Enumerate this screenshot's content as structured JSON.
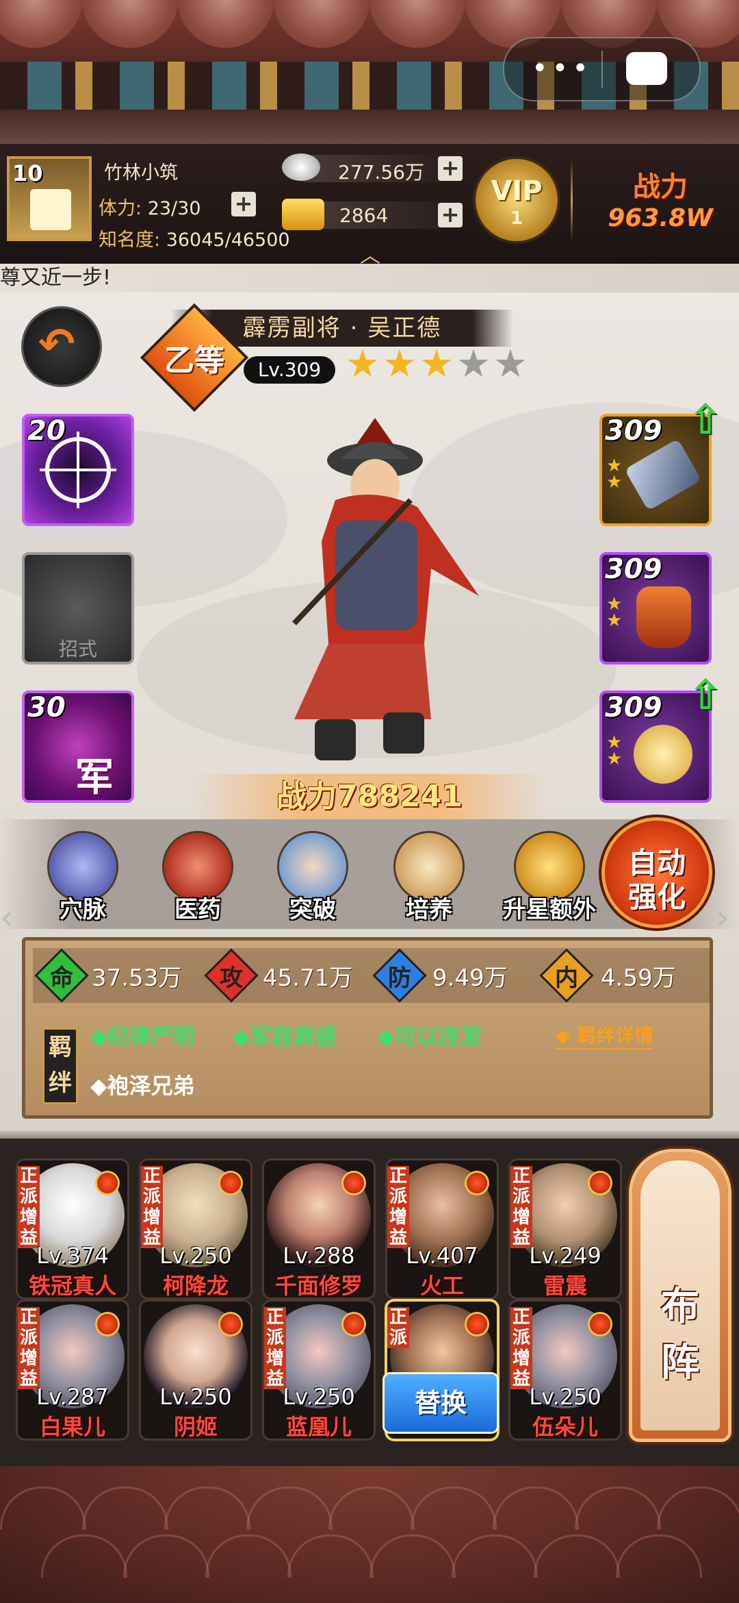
{
  "player": {
    "avatar_level": "10",
    "name": "竹林小筑",
    "stamina_label": "体力:",
    "stamina_value": "23/30",
    "fame_label": "知名度:",
    "fame_value": "36045/46500"
  },
  "currency": {
    "silver": "277.56万",
    "gold": "2864"
  },
  "vip": {
    "label": "VIP",
    "level": "1"
  },
  "top_power": {
    "label": "战力",
    "value": "963.8W"
  },
  "ticker": "尊又近一步!",
  "hero": {
    "title": "霹雳副将 · 吴正德",
    "grade": "乙等",
    "level": "Lv.309",
    "stars_filled": 3,
    "stars_total": 5,
    "power": "战力788241"
  },
  "left_slots": [
    {
      "num": "20",
      "label": ""
    },
    {
      "num": "",
      "label": "招式"
    },
    {
      "num": "30",
      "label": "军"
    }
  ],
  "right_slots": [
    {
      "num": "309"
    },
    {
      "num": "309"
    },
    {
      "num": "309"
    }
  ],
  "functions": [
    "穴脉",
    "医药",
    "突破",
    "培养",
    "升星额外"
  ],
  "auto_button": [
    "自动",
    "强化"
  ],
  "stats": [
    {
      "label": "命",
      "value": "37.53万",
      "color": "#2fbf3a"
    },
    {
      "label": "攻",
      "value": "45.71万",
      "color": "#e0302a"
    },
    {
      "label": "防",
      "value": "9.49万",
      "color": "#2f7fe0"
    },
    {
      "label": "内",
      "value": "4.59万",
      "color": "#e8a020"
    }
  ],
  "bonds": {
    "label": "羁绊",
    "active": [
      "◆纪律严明",
      "◆军容鼎盛",
      "◆可以连发"
    ],
    "inactive": [
      "◆袍泽兄弟"
    ],
    "detail_link": "◆ 羁绊详情"
  },
  "team": [
    {
      "level": "Lv.374",
      "name": "铁冠真人",
      "tag": "正派增益"
    },
    {
      "level": "Lv.250",
      "name": "柯降龙",
      "tag": "正派增益"
    },
    {
      "level": "Lv.288",
      "name": "千面修罗",
      "tag": ""
    },
    {
      "level": "Lv.407",
      "name": "火工",
      "tag": "正派增益"
    },
    {
      "level": "Lv.249",
      "name": "雷震",
      "tag": "正派增益"
    },
    {
      "level": "Lv.287",
      "name": "白果儿",
      "tag": "正派增益"
    },
    {
      "level": "Lv.250",
      "name": "阴姬",
      "tag": ""
    },
    {
      "level": "Lv.250",
      "name": "蓝凰儿",
      "tag": "正派增益"
    },
    {
      "level": "",
      "name": "",
      "tag": "正派"
    },
    {
      "level": "Lv.250",
      "name": "伍朵儿",
      "tag": "正派增益"
    }
  ],
  "swap_button": "替换",
  "lineup_button": [
    "布",
    "阵"
  ],
  "colors": {
    "accent": "#f07a20",
    "panel": "#b58e60",
    "bond_active": "#3ce06a"
  }
}
